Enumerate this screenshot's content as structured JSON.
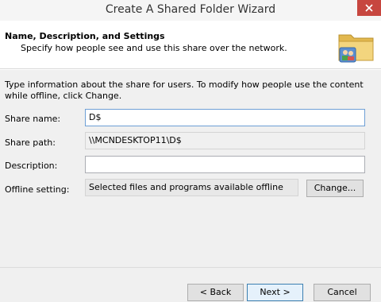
{
  "window": {
    "title": "Create A Shared Folder Wizard"
  },
  "header": {
    "title": "Name, Description, and Settings",
    "subtitle": "Specify how people see and use this share over the network."
  },
  "intro": "Type information about the share for users. To modify how people use the content while offline, click Change.",
  "fields": {
    "share_name": {
      "label": "Share name:",
      "value": "D$"
    },
    "share_path": {
      "label": "Share path:",
      "value": "\\\\MCNDESKTOP11\\D$"
    },
    "description": {
      "label": "Description:",
      "value": ""
    },
    "offline": {
      "label": "Offline setting:",
      "value": "Selected files and programs available offline",
      "change_label": "Change..."
    }
  },
  "buttons": {
    "back": "< Back",
    "next": "Next >",
    "cancel": "Cancel"
  }
}
